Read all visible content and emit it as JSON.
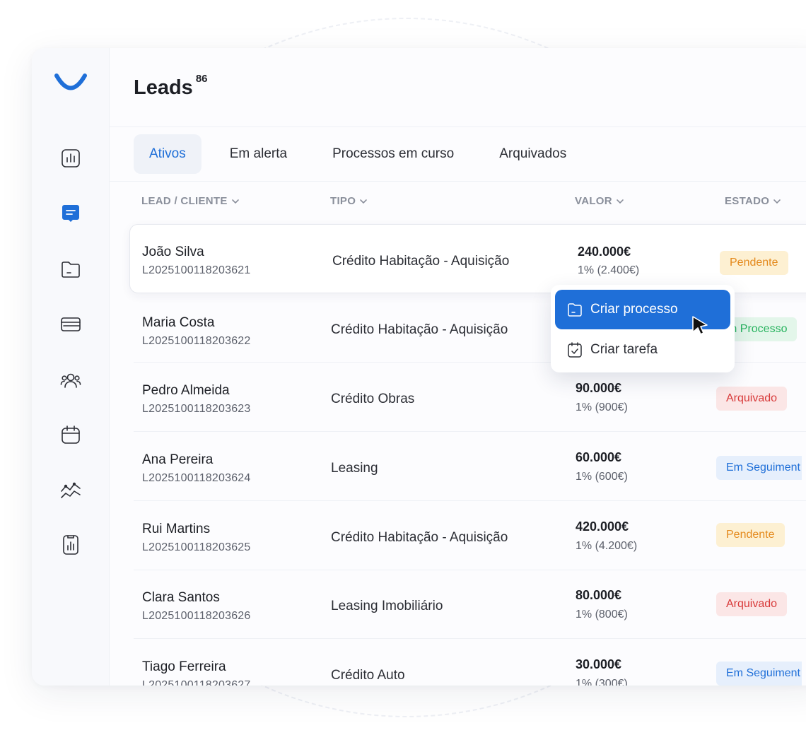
{
  "page": {
    "title": "Leads",
    "count": "86"
  },
  "tabs": [
    {
      "label": "Ativos",
      "active": true
    },
    {
      "label": "Em alerta",
      "active": false
    },
    {
      "label": "Processos em curso",
      "active": false
    },
    {
      "label": "Arquivados",
      "active": false
    }
  ],
  "columns": {
    "lead": "LEAD / CLIENTE",
    "tipo": "TIPO",
    "valor": "VALOR",
    "estado": "ESTADO"
  },
  "rows": [
    {
      "name": "João Silva",
      "id": "L2025100118203621",
      "type": "Crédito Habitação - Aquisição",
      "value": "240.000€",
      "pct": "1% (2.400€)",
      "status": "Pendente"
    },
    {
      "name": "Maria Costa",
      "id": "L2025100118203622",
      "type": "Crédito Habitação - Aquisição",
      "value": "",
      "pct": "",
      "status": "m Processo"
    },
    {
      "name": "Pedro Almeida",
      "id": "L2025100118203623",
      "type": "Crédito Obras",
      "value": "90.000€",
      "pct": "1% (900€)",
      "status": "Arquivado"
    },
    {
      "name": "Ana Pereira",
      "id": "L2025100118203624",
      "type": "Leasing",
      "value": "60.000€",
      "pct": "1% (600€)",
      "status": "Em Seguiment"
    },
    {
      "name": "Rui Martins",
      "id": "L2025100118203625",
      "type": "Crédito Habitação - Aquisição",
      "value": "420.000€",
      "pct": "1% (4.200€)",
      "status": "Pendente"
    },
    {
      "name": "Clara Santos",
      "id": "L2025100118203626",
      "type": "Leasing Imobiliário",
      "value": "80.000€",
      "pct": "1% (800€)",
      "status": "Arquivado"
    },
    {
      "name": "Tiago Ferreira",
      "id": "L2025100118203627",
      "type": "Crédito Auto",
      "value": "30.000€",
      "pct": "1% (300€)",
      "status": "Em Seguiment"
    }
  ],
  "context_menu": {
    "items": [
      {
        "label": "Criar processo",
        "icon": "folder-icon",
        "active": true
      },
      {
        "label": "Criar tarefa",
        "icon": "calendar-check-icon",
        "active": false
      }
    ]
  },
  "colors": {
    "accent": "#1f6fd8",
    "pendente": "#e48a1d",
    "arquivado": "#d83a3a",
    "processo": "#27b35e"
  },
  "sidebar": {
    "icons": [
      "bar-chart-icon",
      "message-icon",
      "folder-icon",
      "credit-card-icon",
      "users-icon",
      "calendar-icon",
      "trend-icon",
      "report-icon"
    ],
    "active": "message-icon"
  }
}
